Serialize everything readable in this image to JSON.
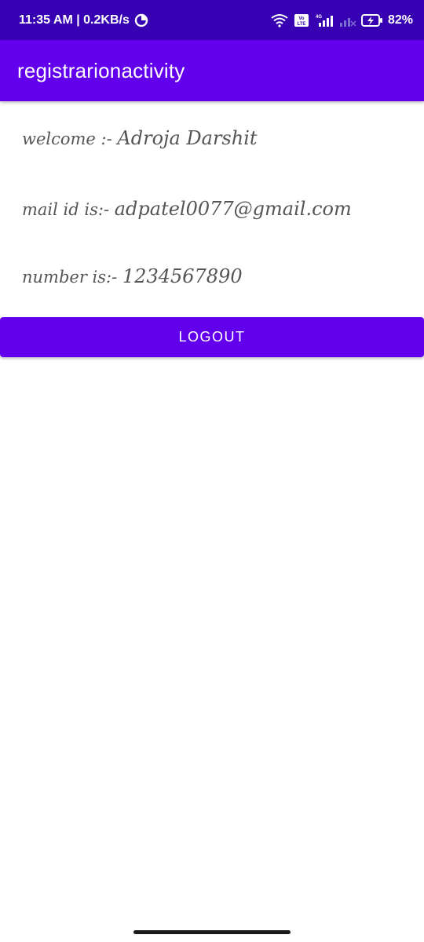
{
  "status_bar": {
    "time_speed": "11:35 AM | 0.2KB/s",
    "volte_label": "Vo LTE",
    "network_label": "4G",
    "battery": "82%",
    "icons": [
      "data-saver-icon",
      "wifi-icon",
      "volte-icon",
      "signal-icon",
      "signal-empty-icon",
      "battery-charging-icon"
    ]
  },
  "app_bar": {
    "title": "registrarionactivity"
  },
  "profile": {
    "welcome_prefix": "welcome :-",
    "name": "Adroja Darshit",
    "mail_prefix": "mail id is:-",
    "mail": "adpatel0077@gmail.com",
    "number_prefix": "number is:-",
    "number": "1234567890"
  },
  "actions": {
    "logout_label": "LOGOUT"
  },
  "colors": {
    "status_bar": "#3700b3",
    "primary": "#6200ee",
    "text": "#555555"
  }
}
